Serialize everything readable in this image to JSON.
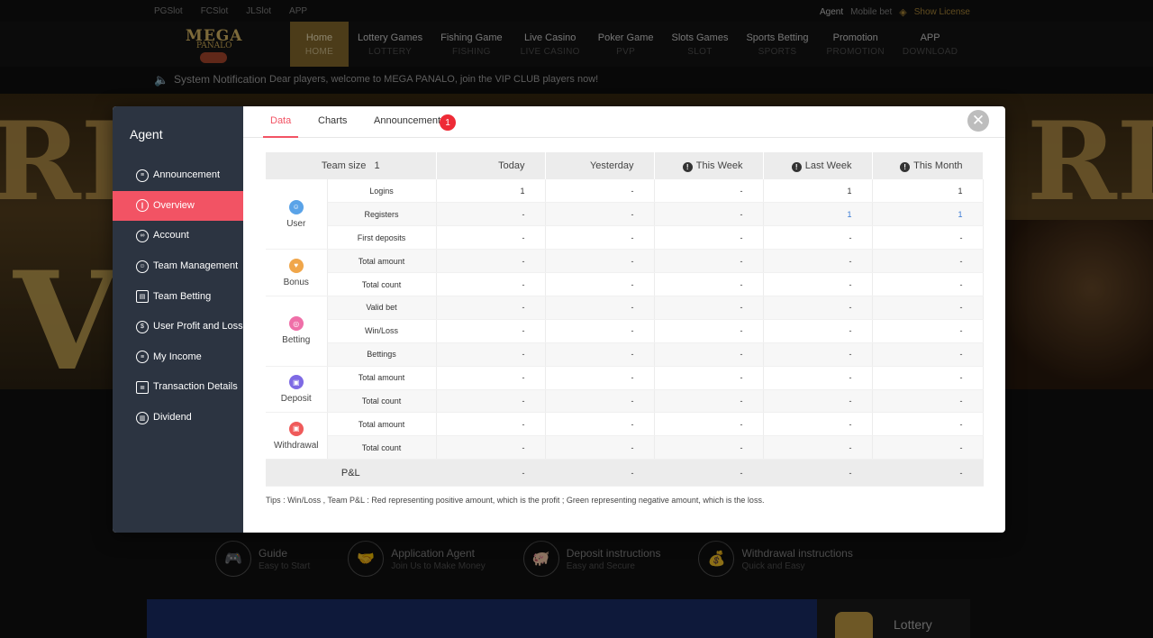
{
  "topbar": {
    "links": [
      "PGSlot",
      "FCSlot",
      "JLSlot",
      "APP"
    ],
    "agent": "Agent",
    "mobile": "Mobile bet",
    "license": "Show License"
  },
  "logo": {
    "line1": "MEGA",
    "line2": "PANALO"
  },
  "nav": [
    {
      "label": "Home",
      "sub": "HOME",
      "active": true
    },
    {
      "label": "Lottery Games",
      "sub": "LOTTERY"
    },
    {
      "label": "Fishing Game",
      "sub": "FISHING"
    },
    {
      "label": "Live Casino",
      "sub": "LIVE CASINO"
    },
    {
      "label": "Poker Game",
      "sub": "PVP"
    },
    {
      "label": "Slots Games",
      "sub": "SLOT"
    },
    {
      "label": "Sports Betting",
      "sub": "SPORTS"
    },
    {
      "label": "Promotion",
      "sub": "PROMOTION"
    },
    {
      "label": "APP",
      "sub": "DOWNLOAD"
    }
  ],
  "notification": {
    "title": "System Notification",
    "text": "Dear players, welcome to MEGA PANALO, join the VIP CLUB players now!"
  },
  "guides": [
    {
      "title": "Guide",
      "sub": "Easy to Start",
      "icon": "gamepad-icon"
    },
    {
      "title": "Application Agent",
      "sub": "Join Us to Make Money",
      "icon": "handshake-icon"
    },
    {
      "title": "Deposit instructions",
      "sub": "Easy and Secure",
      "icon": "piggy-bank-icon"
    },
    {
      "title": "Withdrawal instructions",
      "sub": "Quick and Easy",
      "icon": "money-bag-icon"
    }
  ],
  "promo_side": {
    "label": "Lottery"
  },
  "modal": {
    "sidebar_title": "Agent",
    "menu": [
      {
        "label": "Announcement",
        "icon": "list-icon"
      },
      {
        "label": "Overview",
        "icon": "chart-icon",
        "active": true
      },
      {
        "label": "Account",
        "icon": "link-icon"
      },
      {
        "label": "Team Management",
        "icon": "user-icon"
      },
      {
        "label": "Team Betting",
        "icon": "wallet-icon"
      },
      {
        "label": "User Profit and Loss",
        "icon": "coin-icon"
      },
      {
        "label": "My Income",
        "icon": "income-icon"
      },
      {
        "label": "Transaction Details",
        "icon": "clipboard-icon"
      },
      {
        "label": "Dividend",
        "icon": "dividend-icon"
      }
    ],
    "tabs": [
      {
        "label": "Data",
        "active": true
      },
      {
        "label": "Charts"
      },
      {
        "label": "Announcement",
        "badge": "1"
      }
    ],
    "table": {
      "team_label": "Team size",
      "team_size": "1",
      "columns": [
        "Today",
        "Yesterday",
        "This Week",
        "Last Week",
        "This Month"
      ],
      "warn_columns": [
        false,
        false,
        true,
        true,
        true
      ],
      "groups": [
        {
          "name": "User",
          "icon": "user-circle-icon",
          "color": "#5aa3e8",
          "rows": [
            {
              "label": "Logins",
              "values": [
                "1",
                "-",
                "-",
                "1",
                "1"
              ]
            },
            {
              "label": "Registers",
              "values": [
                "-",
                "-",
                "-",
                "1",
                "1"
              ],
              "blue": [
                false,
                false,
                false,
                true,
                true
              ]
            },
            {
              "label": "First deposits",
              "values": [
                "-",
                "-",
                "-",
                "-",
                "-"
              ]
            }
          ]
        },
        {
          "name": "Bonus",
          "icon": "gift-icon",
          "color": "#f0a64a",
          "rows": [
            {
              "label": "Total amount",
              "values": [
                "-",
                "-",
                "-",
                "-",
                "-"
              ]
            },
            {
              "label": "Total count",
              "values": [
                "-",
                "-",
                "-",
                "-",
                "-"
              ]
            }
          ]
        },
        {
          "name": "Betting",
          "icon": "chip-icon",
          "color": "#ef6fa8",
          "rows": [
            {
              "label": "Valid bet",
              "values": [
                "-",
                "-",
                "-",
                "-",
                "-"
              ]
            },
            {
              "label": "Win/Loss",
              "values": [
                "-",
                "-",
                "-",
                "-",
                "-"
              ]
            },
            {
              "label": "Bettings",
              "values": [
                "-",
                "-",
                "-",
                "-",
                "-"
              ]
            }
          ]
        },
        {
          "name": "Deposit",
          "icon": "deposit-icon",
          "color": "#7e6ae4",
          "rows": [
            {
              "label": "Total amount",
              "values": [
                "-",
                "-",
                "-",
                "-",
                "-"
              ]
            },
            {
              "label": "Total count",
              "values": [
                "-",
                "-",
                "-",
                "-",
                "-"
              ]
            }
          ]
        },
        {
          "name": "Withdrawal",
          "icon": "withdraw-icon",
          "color": "#ef5a5a",
          "rows": [
            {
              "label": "Total amount",
              "values": [
                "-",
                "-",
                "-",
                "-",
                "-"
              ]
            },
            {
              "label": "Total count",
              "values": [
                "-",
                "-",
                "-",
                "-",
                "-"
              ]
            }
          ]
        }
      ],
      "pl_label": "P&L",
      "pl_values": [
        "-",
        "-",
        "-",
        "-",
        "-"
      ]
    },
    "tips": "Tips : Win/Loss , Team P&L : Red representing positive amount, which is the profit ; Green representing negative amount, which is the loss."
  }
}
